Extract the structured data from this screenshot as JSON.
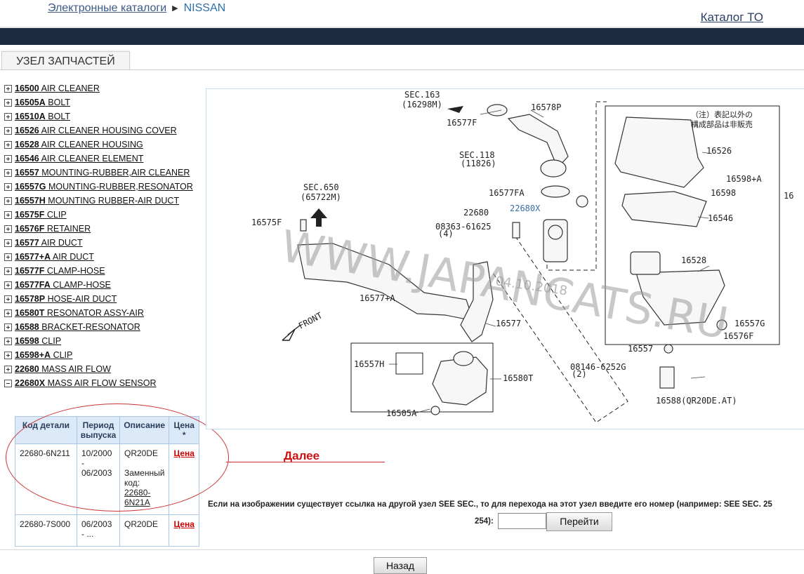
{
  "header": {
    "breadcrumb_root": "Электронные каталоги",
    "breadcrumb_current": "NISSAN",
    "catalog_link": "Каталог ТО"
  },
  "tab_label": "УЗЕЛ ЗАПЧАСТЕЙ",
  "tree": [
    {
      "code": "16500",
      "name": "AIR CLEANER"
    },
    {
      "code": "16505A",
      "name": "BOLT"
    },
    {
      "code": "16510A",
      "name": "BOLT"
    },
    {
      "code": "16526",
      "name": "AIR CLEANER HOUSING COVER"
    },
    {
      "code": "16528",
      "name": "AIR CLEANER HOUSING"
    },
    {
      "code": "16546",
      "name": "AIR CLEANER ELEMENT"
    },
    {
      "code": "16557",
      "name": "MOUNTING-RUBBER,AIR CLEANER"
    },
    {
      "code": "16557G",
      "name": "MOUNTING-RUBBER,RESONATOR"
    },
    {
      "code": "16557H",
      "name": "MOUNTING RUBBER-AIR DUCT"
    },
    {
      "code": "16575F",
      "name": "CLIP"
    },
    {
      "code": "16576F",
      "name": "RETAINER"
    },
    {
      "code": "16577",
      "name": "AIR DUCT"
    },
    {
      "code": "16577+A",
      "name": "AIR DUCT"
    },
    {
      "code": "16577F",
      "name": "CLAMP-HOSE"
    },
    {
      "code": "16577FA",
      "name": "CLAMP-HOSE"
    },
    {
      "code": "16578P",
      "name": "HOSE-AIR DUCT"
    },
    {
      "code": "16580T",
      "name": "RESONATOR ASSY-AIR"
    },
    {
      "code": "16588",
      "name": "BRACKET-RESONATOR"
    },
    {
      "code": "16598",
      "name": "CLIP"
    },
    {
      "code": "16598+A",
      "name": "CLIP"
    },
    {
      "code": "22680",
      "name": "MASS AIR FLOW"
    },
    {
      "code": "22680X",
      "name": "MASS AIR FLOW SENSOR"
    }
  ],
  "table": {
    "headers": [
      "Код детали",
      "Период выпуска",
      "Описание",
      "Цена *"
    ],
    "rows": [
      {
        "code": "22680-6N211",
        "period": "10/2000 - 06/2003",
        "desc": "QR20DE",
        "replace_label": "Заменный код:",
        "replace_code": "22680-6N21A",
        "price": "Цена"
      },
      {
        "code": "22680-7S000",
        "period": "06/2003 - ...",
        "desc": "QR20DE",
        "price": "Цена"
      }
    ]
  },
  "diagram": {
    "watermark": "WWW.JAPANCATS.RU",
    "date_stamp": "04.10.2018",
    "note": [
      "（注）表記以外の",
      "構成部品は非販売"
    ],
    "labels": [
      "SEC.163",
      "(16298M)",
      "16578P",
      "16577F",
      "SEC.118",
      "(11826)",
      "16526",
      "16598+A",
      "16598",
      "SEC.650",
      "(65722M)",
      "16577FA",
      "22680",
      "22680X",
      "16546",
      "16575F",
      "08363-61625",
      "(4)",
      "16528",
      "16577+A",
      "16577",
      "FRONT",
      "16557G",
      "16576F",
      "16557H",
      "16557",
      "08146-6252G",
      "(2)",
      "16580T",
      "16588(QR20DE.AT)",
      "16505A",
      "16"
    ]
  },
  "next_label": "Далее",
  "sec_note": {
    "line1": "Если на изображении существует ссылка на другой узел SEE SEC., то для перехода на этот узел введите его номер (например: SEE SEC. 25",
    "line2": "254):",
    "button": "Перейти",
    "input_value": ""
  },
  "back_button": "Назад",
  "colors": {
    "nav_bar": "#1b2b3f",
    "table_header": "#dbe9f8",
    "price_link": "#cc0000",
    "annotation": "#cc1111"
  }
}
